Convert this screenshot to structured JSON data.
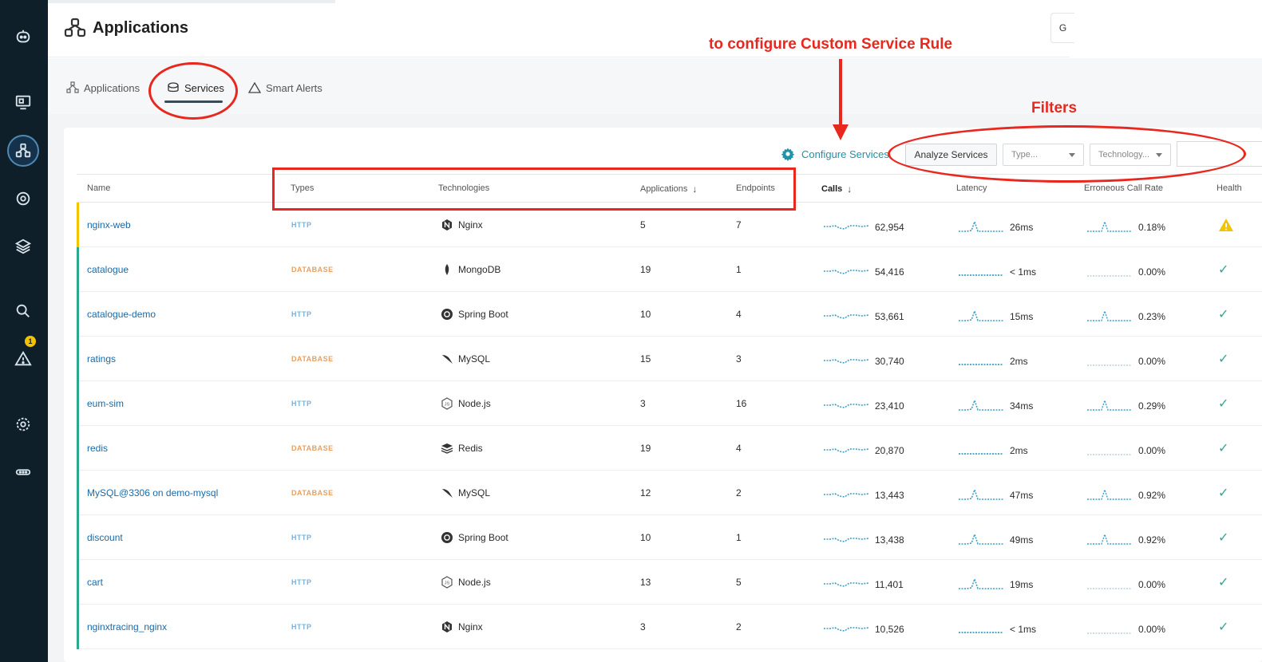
{
  "app": {
    "title": "Applications",
    "corner_button": "G"
  },
  "nav": {
    "alert_badge": "1",
    "icons": [
      "robot-icon",
      "infrastructure-icon",
      "applications-icon",
      "platforms-icon",
      "stack-icon",
      "analytics-icon",
      "alert-icon",
      "settings-icon",
      "more-icon"
    ]
  },
  "tabs": [
    {
      "label": "Applications"
    },
    {
      "label": "Services"
    },
    {
      "label": "Smart Alerts"
    }
  ],
  "toolbar": {
    "configure_label": "Configure Services",
    "analyze_label": "Analyze Services",
    "type_placeholder": "Type...",
    "technology_placeholder": "Technology...",
    "filter_value": ""
  },
  "table": {
    "headers": [
      "Name",
      "Types",
      "Technologies",
      "Applications",
      "Endpoints",
      "Calls",
      "Latency",
      "Erroneous Call Rate",
      "Health"
    ],
    "rows": [
      {
        "name": "nginx-web",
        "type": "HTTP",
        "tech": "Nginx",
        "apps": "5",
        "endpoints": "7",
        "calls": "62,954",
        "latency": "26ms",
        "error_rate": "0.18%",
        "health": "warning"
      },
      {
        "name": "catalogue",
        "type": "DATABASE",
        "tech": "MongoDB",
        "apps": "19",
        "endpoints": "1",
        "calls": "54,416",
        "latency": "< 1ms",
        "error_rate": "0.00%",
        "health": "ok"
      },
      {
        "name": "catalogue-demo",
        "type": "HTTP",
        "tech": "Spring Boot",
        "apps": "10",
        "endpoints": "4",
        "calls": "53,661",
        "latency": "15ms",
        "error_rate": "0.23%",
        "health": "ok"
      },
      {
        "name": "ratings",
        "type": "DATABASE",
        "tech": "MySQL",
        "apps": "15",
        "endpoints": "3",
        "calls": "30,740",
        "latency": "2ms",
        "error_rate": "0.00%",
        "health": "ok"
      },
      {
        "name": "eum-sim",
        "type": "HTTP",
        "tech": "Node.js",
        "apps": "3",
        "endpoints": "16",
        "calls": "23,410",
        "latency": "34ms",
        "error_rate": "0.29%",
        "health": "ok"
      },
      {
        "name": "redis",
        "type": "DATABASE",
        "tech": "Redis",
        "apps": "19",
        "endpoints": "4",
        "calls": "20,870",
        "latency": "2ms",
        "error_rate": "0.00%",
        "health": "ok"
      },
      {
        "name": "MySQL@3306 on demo-mysql",
        "type": "DATABASE",
        "tech": "MySQL",
        "apps": "12",
        "endpoints": "2",
        "calls": "13,443",
        "latency": "47ms",
        "error_rate": "0.92%",
        "health": "ok"
      },
      {
        "name": "discount",
        "type": "HTTP",
        "tech": "Spring Boot",
        "apps": "10",
        "endpoints": "1",
        "calls": "13,438",
        "latency": "49ms",
        "error_rate": "0.92%",
        "health": "ok"
      },
      {
        "name": "cart",
        "type": "HTTP",
        "tech": "Node.js",
        "apps": "13",
        "endpoints": "5",
        "calls": "11,401",
        "latency": "19ms",
        "error_rate": "0.00%",
        "health": "ok"
      },
      {
        "name": "nginxtracing_nginx",
        "type": "HTTP",
        "tech": "Nginx",
        "apps": "3",
        "endpoints": "2",
        "calls": "10,526",
        "latency": "< 1ms",
        "error_rate": "0.00%",
        "health": "ok"
      }
    ]
  },
  "annotations": {
    "configure_note": "to configure Custom Service Rule",
    "filters_note": "Filters"
  },
  "colors": {
    "accent": "#1f93a8",
    "link": "#1a6aa8",
    "annotation": "#e8281e",
    "ok": "#2ba98f",
    "warning": "#f2c400"
  }
}
